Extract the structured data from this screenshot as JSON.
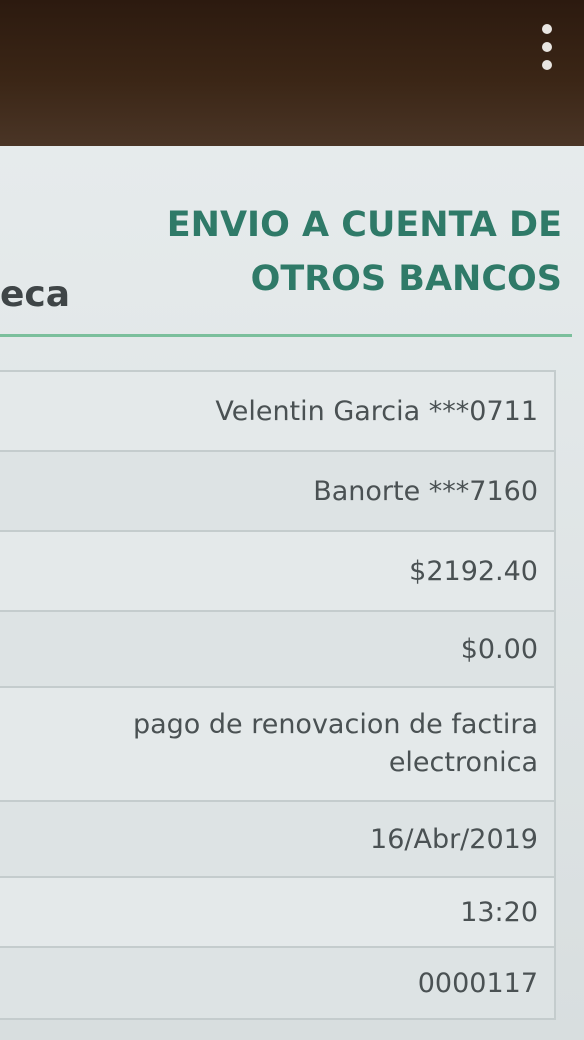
{
  "topbar": {
    "menu_icon": "more-vert-icon"
  },
  "header": {
    "logo_fragment": "eca",
    "title": "ENVIO A CUENTA DE OTROS BANCOS"
  },
  "rows": [
    {
      "value": "Velentin Garcia ***0711"
    },
    {
      "value": "Banorte  ***7160"
    },
    {
      "value": "$2192.40"
    },
    {
      "value": "$0.00"
    },
    {
      "value": "pago de renovacion de factira electronica"
    },
    {
      "value": "16/Abr/2019"
    },
    {
      "value": "13:20"
    },
    {
      "value": "0000117"
    }
  ],
  "colors": {
    "title": "#2f7a68",
    "rule": "#7bbf9c",
    "text": "#4a5153"
  }
}
